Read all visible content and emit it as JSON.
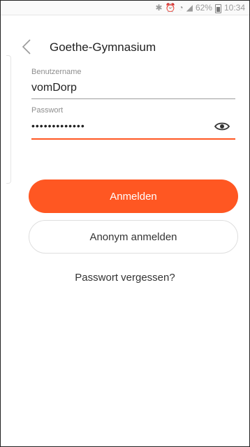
{
  "status_bar": {
    "battery_percent": "62%",
    "time": "10:34",
    "icons": [
      "bluetooth-icon",
      "alarm-icon",
      "wifi-icon",
      "signal-icon",
      "battery-icon"
    ]
  },
  "header": {
    "title": "Goethe-Gymnasium"
  },
  "username": {
    "label": "Benutzername",
    "value": "vomDorp"
  },
  "password": {
    "label": "Passwort",
    "value": "•••••••••••••"
  },
  "buttons": {
    "login": "Anmelden",
    "anonymous_login": "Anonym anmelden"
  },
  "links": {
    "forgot_password": "Passwort vergessen?"
  },
  "colors": {
    "accent": "#ff5722",
    "text": "#222222",
    "muted": "#8e8e8e"
  }
}
